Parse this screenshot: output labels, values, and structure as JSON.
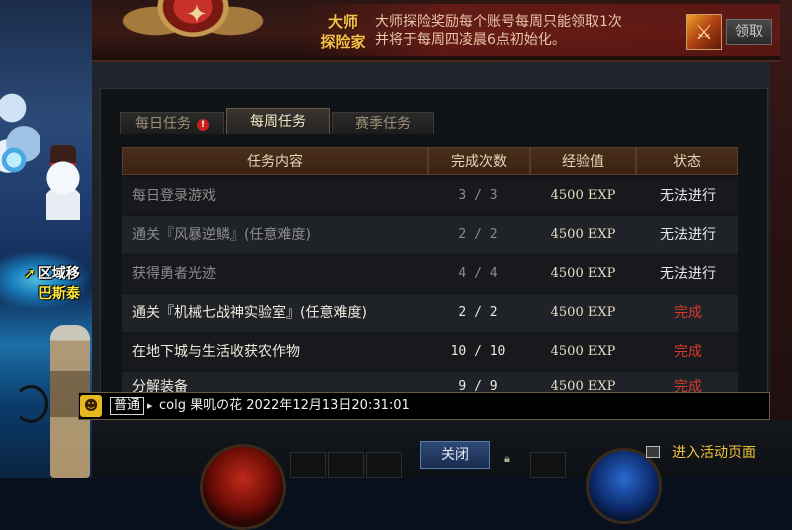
{
  "scene": {
    "portal_line1": "区域移",
    "portal_line2": "巴斯泰"
  },
  "banner": {
    "title_line1": "大师",
    "title_line2": "探险家",
    "text_line1": "大师探险奖励每个账号每周只能领取1次",
    "text_line2": "并将于每周四凌晨6点初始化。",
    "claim_label": "领取",
    "reward_icon": "reward-box-icon"
  },
  "tabs": [
    {
      "label": "每日任务",
      "active": false,
      "alert": "!"
    },
    {
      "label": "每周任务",
      "active": true
    },
    {
      "label": "赛季任务",
      "active": false
    }
  ],
  "table": {
    "headers": [
      "任务内容",
      "完成次数",
      "经验值",
      "状态"
    ],
    "rows": [
      {
        "name": "每日登录游戏",
        "count": "3 / 3",
        "exp": "4500 EXP",
        "status": "无法进行",
        "state": "unavailable"
      },
      {
        "name": "通关『风暴逆鳞』(任意难度)",
        "count": "2 / 2",
        "exp": "4500 EXP",
        "status": "无法进行",
        "state": "unavailable"
      },
      {
        "name": "获得勇者光迹",
        "count": "4 / 4",
        "exp": "4500 EXP",
        "status": "无法进行",
        "state": "unavailable"
      },
      {
        "name": "通关『机械七战神实验室』(任意难度)",
        "count": "2 / 2",
        "exp": "4500 EXP",
        "status": "完成",
        "state": "done"
      },
      {
        "name": "在地下城与生活收获农作物",
        "count": "10 / 10",
        "exp": "4500 EXP",
        "status": "完成",
        "state": "done"
      },
      {
        "name": "分解装备",
        "count": "9 / 9",
        "exp": "4500 EXP",
        "status": "完成",
        "state": "done"
      }
    ]
  },
  "chat": {
    "channel": "普通",
    "message": "colg 果叽の花 2022年12月13日20:31:01"
  },
  "footer": {
    "close_label": "关闭",
    "goto_label": "进入活动页面"
  },
  "colors": {
    "done": "#d63a2a",
    "header_bg": "#3a2214",
    "accent_gold": "#f2c23a"
  }
}
